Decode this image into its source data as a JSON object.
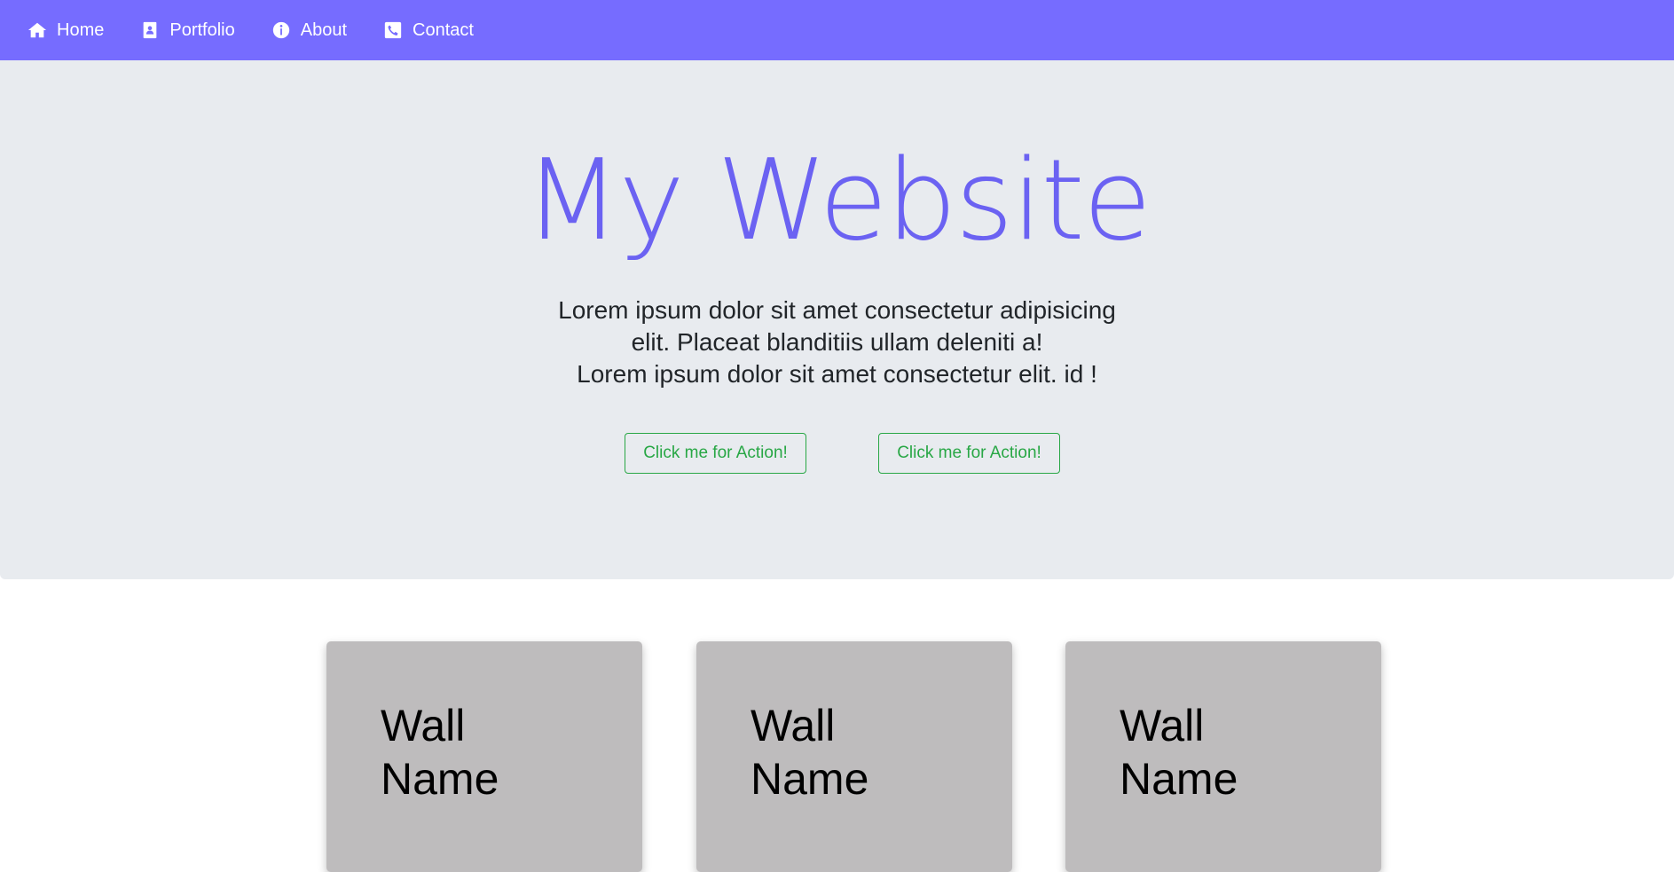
{
  "nav": {
    "items": [
      {
        "label": "Home",
        "icon": "home-icon"
      },
      {
        "label": "Portfolio",
        "icon": "portfolio-icon"
      },
      {
        "label": "About",
        "icon": "info-icon"
      },
      {
        "label": "Contact",
        "icon": "phone-icon"
      }
    ],
    "background": "#766cff"
  },
  "hero": {
    "title": "My Website",
    "text_line1": "Lorem ipsum dolor sit amet consectetur adipisicing",
    "text_line2": "elit. Placeat blanditiis ullam deleniti a!",
    "text_line3": "Lorem ipsum dolor sit amet consectetur elit. id !",
    "button1_label": "Click me for Action!",
    "button2_label": "Click me for Action!",
    "title_color": "#6b62f2",
    "button_color": "#28a745",
    "background": "#e8ebef"
  },
  "cards": [
    {
      "title": "Wall Name"
    },
    {
      "title": "Wall Name"
    },
    {
      "title": "Wall Name"
    }
  ]
}
